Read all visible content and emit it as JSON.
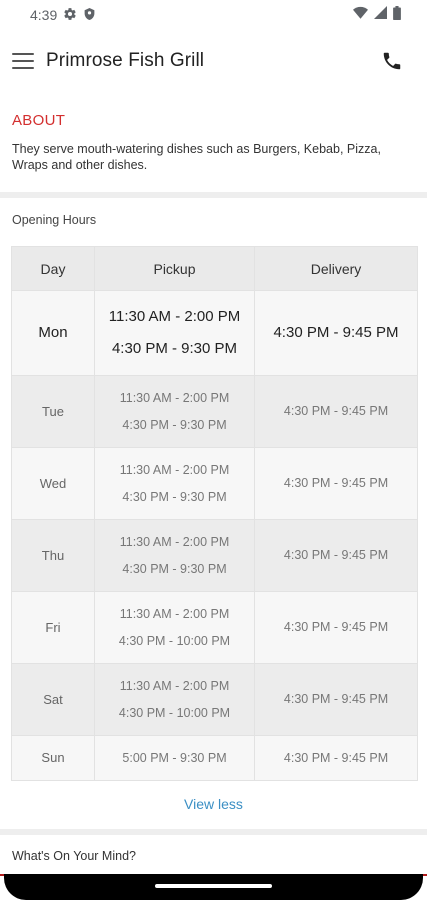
{
  "status_bar": {
    "time": "4:39",
    "icons": [
      "gear-icon",
      "shield-icon",
      "wifi-icon",
      "signal-icon",
      "battery-icon"
    ]
  },
  "app_bar": {
    "title": "Primrose Fish Grill",
    "menu_icon": "hamburger-menu-icon",
    "call_icon": "phone-icon"
  },
  "about": {
    "title": "ABOUT",
    "text": "They serve mouth-watering dishes such as Burgers, Kebab, Pizza, Wraps and other dishes."
  },
  "opening_hours": {
    "label": "Opening Hours",
    "headers": [
      "Day",
      "Pickup",
      "Delivery"
    ],
    "rows": [
      {
        "day": "Mon",
        "pickup1": "11:30 AM - 2:00 PM",
        "pickup2": "4:30 PM - 9:30 PM",
        "delivery": "4:30 PM - 9:45 PM"
      },
      {
        "day": "Tue",
        "pickup1": "11:30 AM - 2:00 PM",
        "pickup2": "4:30 PM - 9:30 PM",
        "delivery": "4:30 PM - 9:45 PM"
      },
      {
        "day": "Wed",
        "pickup1": "11:30 AM - 2:00 PM",
        "pickup2": "4:30 PM - 9:30 PM",
        "delivery": "4:30 PM - 9:45 PM"
      },
      {
        "day": "Thu",
        "pickup1": "11:30 AM - 2:00 PM",
        "pickup2": "4:30 PM - 9:30 PM",
        "delivery": "4:30 PM - 9:45 PM"
      },
      {
        "day": "Fri",
        "pickup1": "11:30 AM - 2:00 PM",
        "pickup2": "4:30 PM - 10:00 PM",
        "delivery": "4:30 PM - 9:45 PM"
      },
      {
        "day": "Sat",
        "pickup1": "11:30 AM - 2:00 PM",
        "pickup2": "4:30 PM - 10:00 PM",
        "delivery": "4:30 PM - 9:45 PM"
      },
      {
        "day": "Sun",
        "pickup1": "5:00 PM - 9:30 PM",
        "pickup2": "",
        "delivery": "4:30 PM - 9:45 PM"
      }
    ],
    "view_toggle": "View less"
  },
  "mind_section": {
    "label": "What's On Your Mind?"
  },
  "colors": {
    "accent_red": "#d32f2f",
    "link_blue": "#3b8fc4"
  }
}
